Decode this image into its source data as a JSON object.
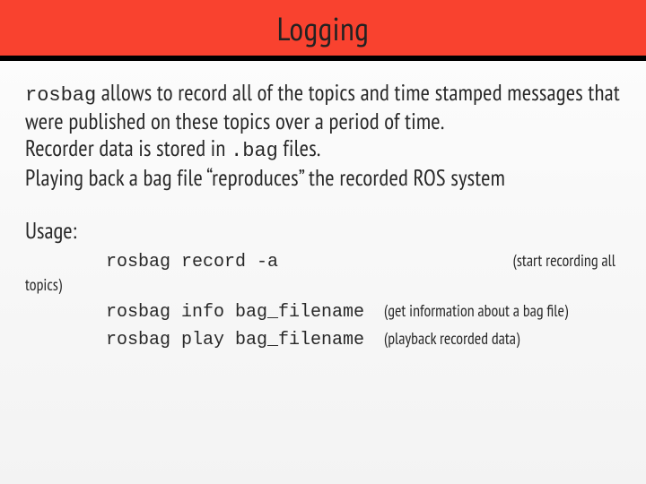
{
  "title": "Logging",
  "body": {
    "inline_code_1": "rosbag",
    "text_1a": " allows to record all of the topics and time stamped messages that were published on these topics over a period of time.",
    "text_2a": "Recorder data is stored in ",
    "inline_code_2": ".bag",
    "text_2b": " files.",
    "text_3": "Playing back a bag file “reproduces” the recorded ROS system"
  },
  "usage_heading": "Usage:",
  "commands": [
    {
      "cmd": "rosbag record -a",
      "desc": "(start recording all"
    },
    {
      "cmd": "rosbag info bag_filename",
      "desc": "(get information about a bag file)"
    },
    {
      "cmd": "rosbag play bag_filename",
      "desc": "(playback recorded data)"
    }
  ],
  "topics_note": "topics)"
}
